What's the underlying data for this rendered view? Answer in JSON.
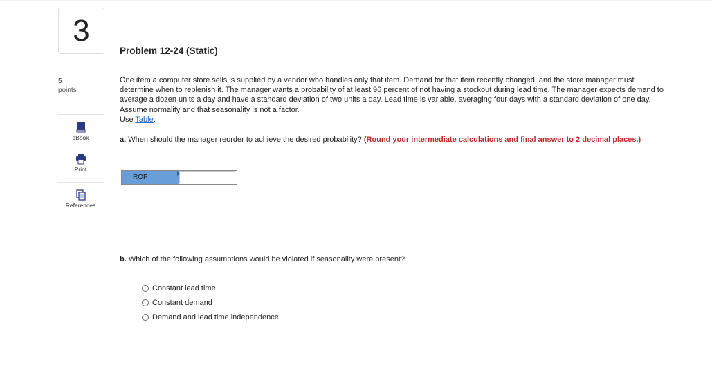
{
  "question": {
    "number": "3",
    "points_value": "5",
    "points_label": "points"
  },
  "tools": [
    {
      "label": "eBook",
      "icon": "ebook-icon"
    },
    {
      "label": "Print",
      "icon": "print-icon"
    },
    {
      "label": "References",
      "icon": "references-icon"
    }
  ],
  "problem": {
    "title": "Problem 12-24 (Static)",
    "body": "One item a computer store sells is supplied by a vendor who handles only that item. Demand for that item recently changed, and the store manager must determine when to replenish it. The manager wants a probability of at least 96 percent of not having a stockout during lead time. The manager expects demand to average a dozen units a day and have a standard deviation of two units a day. Lead time is variable, averaging four days with a standard deviation of one day. Assume normality and that seasonality is not a factor.",
    "use_prefix": "Use ",
    "table_link": "Table",
    "use_suffix": "."
  },
  "part_a": {
    "lead": "a.",
    "question": " When should the manager reorder to achieve the desired probability? ",
    "instruction": "(Round your intermediate calculations and final answer to 2 decimal places.)",
    "rop_label": "ROP",
    "rop_value": ""
  },
  "part_b": {
    "lead": "b.",
    "question": " Which of the following assumptions would be violated if seasonality were present?",
    "options": [
      "Constant lead time",
      "Constant demand",
      "Demand and lead time independence"
    ]
  },
  "colors": {
    "accent_red": "#c0272d",
    "link_blue": "#2a6ebb",
    "rop_fill": "#6a9ed8"
  }
}
